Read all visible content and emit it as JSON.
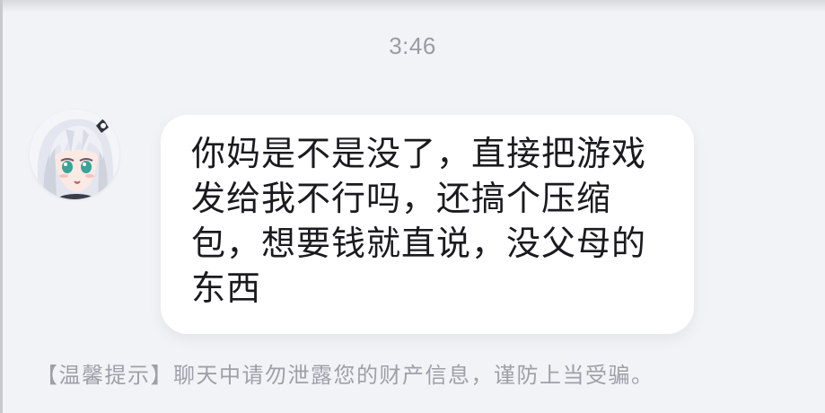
{
  "chat": {
    "timestamp": "3:46",
    "message": {
      "sender_avatar": "anime-girl-avatar",
      "text": "你妈是不是没了，直接把游戏发给我不行吗，还搞个压缩包，想要钱就直说，没父母的东西"
    },
    "system_tip": "【温馨提示】聊天中请勿泄露您的财产信息，谨防上当受骗。"
  },
  "colors": {
    "background": "#f2f3f7",
    "bubble": "#ffffff",
    "message_text": "#1b1b1f",
    "muted_text": "#9a9ca3"
  }
}
